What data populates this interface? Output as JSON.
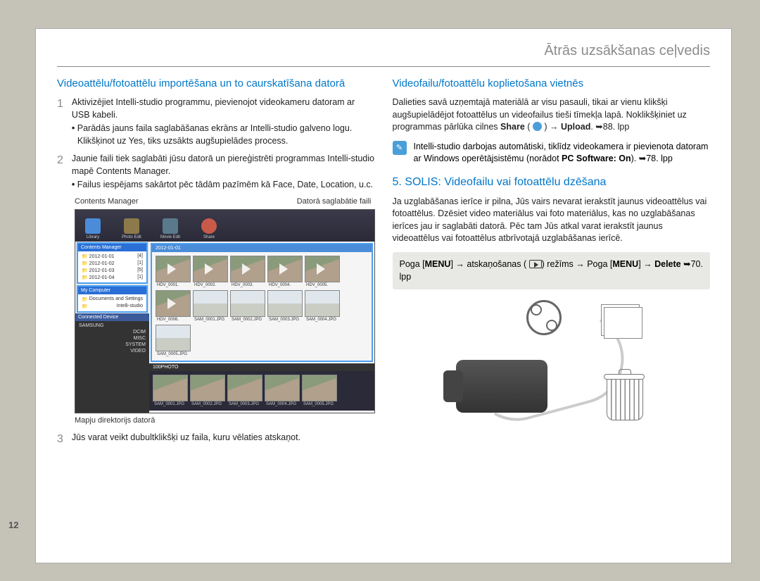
{
  "header": {
    "title": "Ātrās uzsākšanas ceļvedis"
  },
  "pageNumber": "12",
  "left": {
    "sectionTitle": "Videoattēlu/fotoattēlu importēšana un to caurskatīšana datorā",
    "step1": {
      "text": "Aktivizējiet Intelli-studio programmu, pievienojot videokameru datoram ar USB kabeli.",
      "bullet1": "Parādās jauns faila saglabāšanas ekrāns ar Intelli-studio galveno logu. Klikšķinot uz Yes, tiks uzsākts augšupielādes process."
    },
    "step2": {
      "text": "Jaunie faili tiek saglabāti jūsu datorā un piereģistrēti programmas Intelli-studio mapē Contents Manager.",
      "bullet1": "Failus iespējams sakārtot pēc tādām pazīmēm kā Face, Date, Location, u.c."
    },
    "captions": {
      "left": "Contents Manager",
      "right": "Datorā saglabātie faili",
      "below": "Mapju direktorijs datorā"
    },
    "step3": {
      "text": "Jūs varat veikt dubultklikšķi uz faila, kuru vēlaties atskaņot."
    },
    "screenshot": {
      "sidebar": {
        "hdr1": "Contents Manager",
        "folders1": [
          {
            "n": "2012-01-01",
            "c": "[4]"
          },
          {
            "n": "2012-01-02",
            "c": "[1]"
          },
          {
            "n": "2012-01-03",
            "c": "[5]"
          },
          {
            "n": "2012-01-04",
            "c": "[1]"
          }
        ],
        "hdr2": "My Computer",
        "folders2": [
          "Documents and Settings",
          "Intelli-studio"
        ],
        "hdr3": "Connected Device",
        "folders3": [
          "SAMSUNG",
          "DCIM",
          "MISC",
          "SYSTEM",
          "VIDEO"
        ]
      },
      "dateHdr": "2012-01-01",
      "row1": [
        "HDV_0001.",
        "HDV_0002.",
        "HDV_0003.",
        "HDV_0004.",
        "HDV_0005.",
        "HDV_0006."
      ],
      "row2": [
        "SAM_0001.JPG",
        "SAM_0002.JPG",
        "SAM_0003.JPG",
        "SAM_0004.JPG",
        "SAM_0005.JPG"
      ],
      "dateHdr2": "100PHOTO",
      "row3": [
        "SAM_0001.JPG",
        "SAM_0002.JPG",
        "SAM_0003.JPG",
        "SAM_0004.JPG",
        "SAM_0005.JPG"
      ]
    }
  },
  "right": {
    "section1Title": "Videofailu/fotoattēlu koplietošana vietnēs",
    "para1a": "Dalieties savā uzņemtajā materiālā ar visu pasauli, tikai ar vienu klikšķi augšupielādējot fotoattēlus un videofailus tieši tīmekļa lapā. Noklikšķiniet uz programmas pārlūka cilnes ",
    "para1_share": "Share",
    "para1_upload": "Upload",
    "para1_ref": "88. lpp",
    "note1a": "Intelli-studio darbojas automātiski, tiklīdz videokamera ir pievienota datoram ar Windows operētājsistēmu (norādot ",
    "note1b": "PC Software: On",
    "note1_ref": "78. lpp",
    "section2Title": "5. SOLIS: Videofailu vai fotoattēlu dzēšana",
    "para2": "Ja uzglabāšanas ierīce ir pilna, Jūs vairs nevarat ierakstīt jaunus videoattēlus vai fotoattēlus. Dzēsiet video materiālus vai foto materiālus, kas no uzglabāšanas ierīces jau ir saglabāti datorā. Pēc tam Jūs atkal varat ierakstīt jaunus videoattēlus vai fotoattēlus atbrīvotajā uzglabāšanas ierīcē.",
    "box": {
      "t1": "Poga [",
      "menu1": "MENU",
      "t2": "] → atskaņošanas (",
      "t3": ") režīms → Poga [",
      "menu2": "MENU",
      "t4": "] → ",
      "del": "Delete",
      "ref": "70. lpp"
    }
  }
}
